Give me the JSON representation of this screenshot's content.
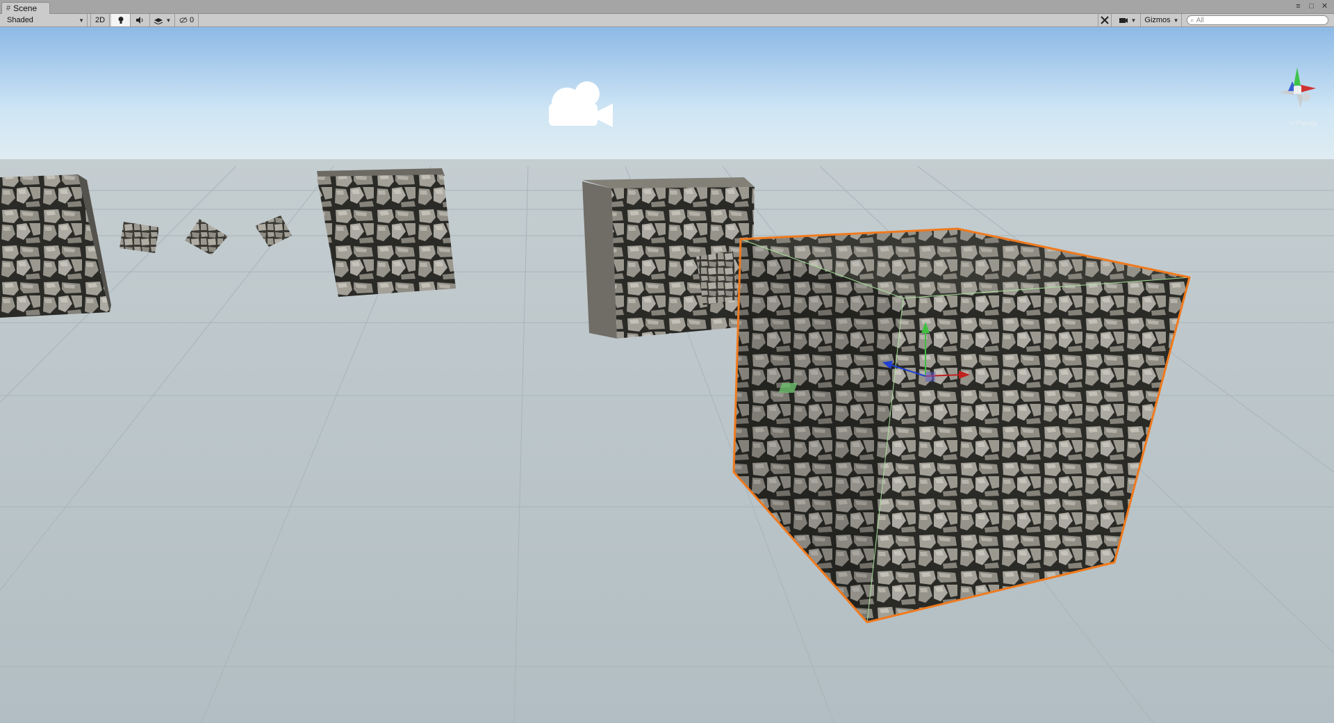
{
  "window": {
    "tab_label": "Scene",
    "tab_icon": "hash-grid-icon",
    "controls": [
      "≡",
      "□",
      "✕"
    ]
  },
  "toolbar": {
    "shading_mode": "Shaded",
    "mode_2d": "2D",
    "hidden_count": "0",
    "gizmos_label": "Gizmos",
    "search_placeholder": "All"
  },
  "scene": {
    "projection": "Persp",
    "selection_color": "#f07a1e",
    "sky_top": "#9ac2e8",
    "ground": "#b7c2c7"
  }
}
